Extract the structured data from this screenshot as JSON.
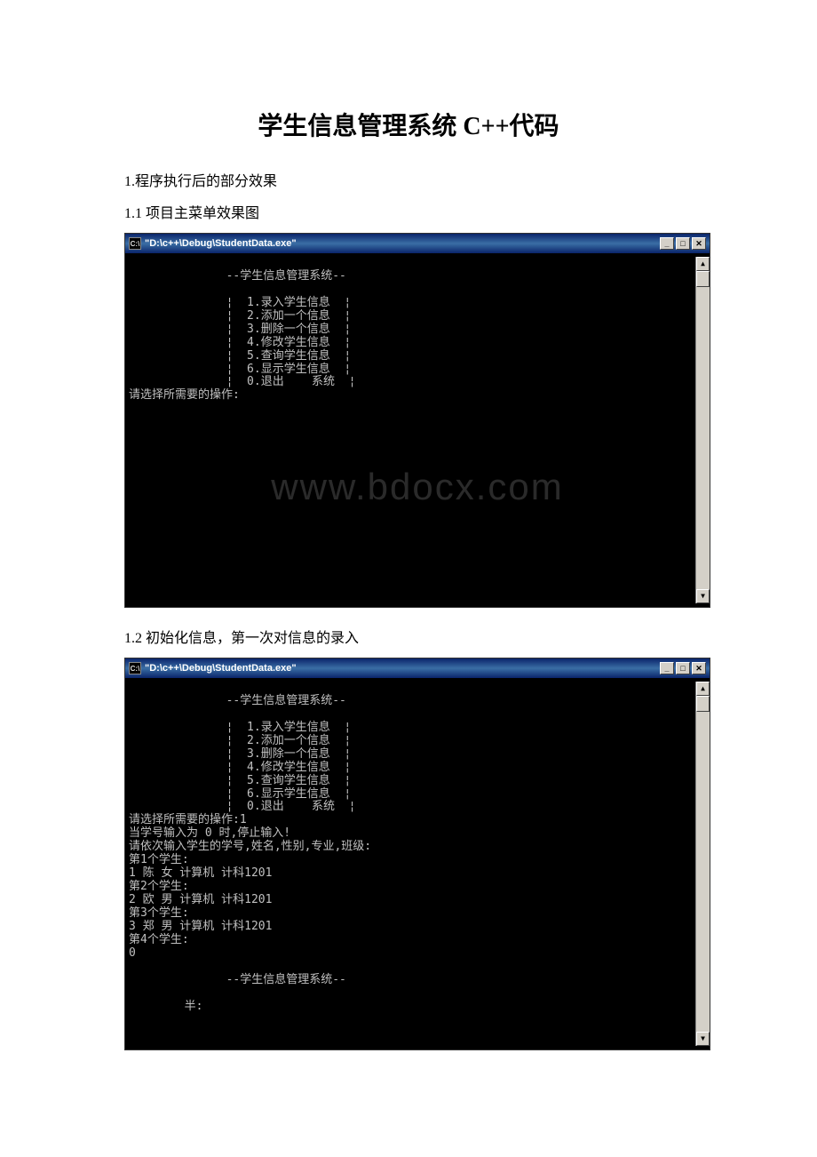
{
  "title": "学生信息管理系统 C++代码",
  "section1": "1.程序执行后的部分效果",
  "section1_1": "1.1 项目主菜单效果图",
  "section1_2": "1.2 初始化信息，第一次对信息的录入",
  "console1": {
    "title": "\"D:\\c++\\Debug\\StudentData.exe\"",
    "header": "              --学生信息管理系统--",
    "menu": "              ¦  1.录入学生信息  ¦\n              ¦  2.添加一个信息  ¦\n              ¦  3.删除一个信息  ¦\n              ¦  4.修改学生信息  ¦\n              ¦  5.查询学生信息  ¦\n              ¦  6.显示学生信息  ¦\n              ¦  0.退出    系统  ¦",
    "prompt": "请选择所需要的操作:",
    "watermark": "www.bdocx.com"
  },
  "console2": {
    "title": "\"D:\\c++\\Debug\\StudentData.exe\"",
    "header": "              --学生信息管理系统--",
    "menu": "              ¦  1.录入学生信息  ¦\n              ¦  2.添加一个信息  ¦\n              ¦  3.删除一个信息  ¦\n              ¦  4.修改学生信息  ¦\n              ¦  5.查询学生信息  ¦\n              ¦  6.显示学生信息  ¦\n              ¦  0.退出    系统  ¦",
    "body": "请选择所需要的操作:1\n当学号输入为 0 时,停止输入!\n请依次输入学生的学号,姓名,性别,专业,班级:\n第1个学生:\n1 陈 女 计算机 计科1201\n第2个学生:\n2 欧 男 计算机 计科1201\n第3个学生:\n3 郑 男 计算机 计科1201\n第4个学生:\n0",
    "footer": "              --学生信息管理系统--",
    "partial": "        半:"
  },
  "win_buttons": {
    "minimize": "_",
    "maximize": "□",
    "close": "✕"
  },
  "scroll": {
    "up": "▲",
    "down": "▼"
  }
}
